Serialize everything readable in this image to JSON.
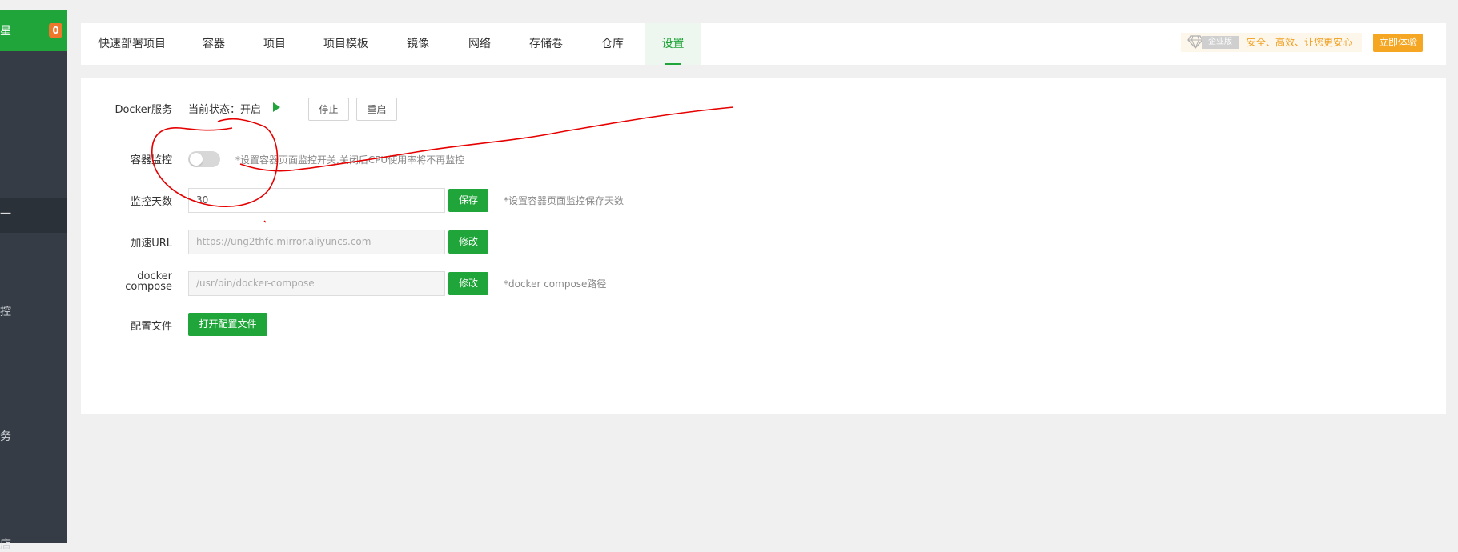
{
  "sidebar": {
    "top_char": "星",
    "badge": "0",
    "active_char": "一",
    "chars": [
      "控",
      "务",
      "店"
    ]
  },
  "tabs": [
    {
      "label": "快速部署项目"
    },
    {
      "label": "容器"
    },
    {
      "label": "项目"
    },
    {
      "label": "项目模板"
    },
    {
      "label": "镜像"
    },
    {
      "label": "网络"
    },
    {
      "label": "存储卷"
    },
    {
      "label": "仓库"
    },
    {
      "label": "设置",
      "active": true
    }
  ],
  "promo": {
    "edition": "企业版",
    "text": "安全、高效、让您更安心",
    "button": "立即体验"
  },
  "settings": {
    "docker_service": {
      "label": "Docker服务",
      "status": "当前状态：开启",
      "stop": "停止",
      "restart": "重启"
    },
    "monitor": {
      "label": "容器监控",
      "enabled": false,
      "hint": "*设置容器页面监控开关,关闭后CPU使用率将不再监控"
    },
    "monitor_days": {
      "label": "监控天数",
      "value": "30",
      "button": "保存",
      "hint": "*设置容器页面监控保存天数"
    },
    "accel_url": {
      "label": "加速URL",
      "value": "https://ung2thfc.mirror.aliyuncs.com",
      "button": "修改"
    },
    "compose": {
      "label_line1": "docker",
      "label_line2": "compose",
      "value": "/usr/bin/docker-compose",
      "button": "修改",
      "hint": "*docker compose路径"
    },
    "config_file": {
      "label": "配置文件",
      "button": "打开配置文件"
    }
  },
  "colors": {
    "accent": "#20a53a",
    "sidebar": "#353c45",
    "badge": "#f0762b",
    "promo": "#f5a623",
    "annotation": "#e60000"
  }
}
